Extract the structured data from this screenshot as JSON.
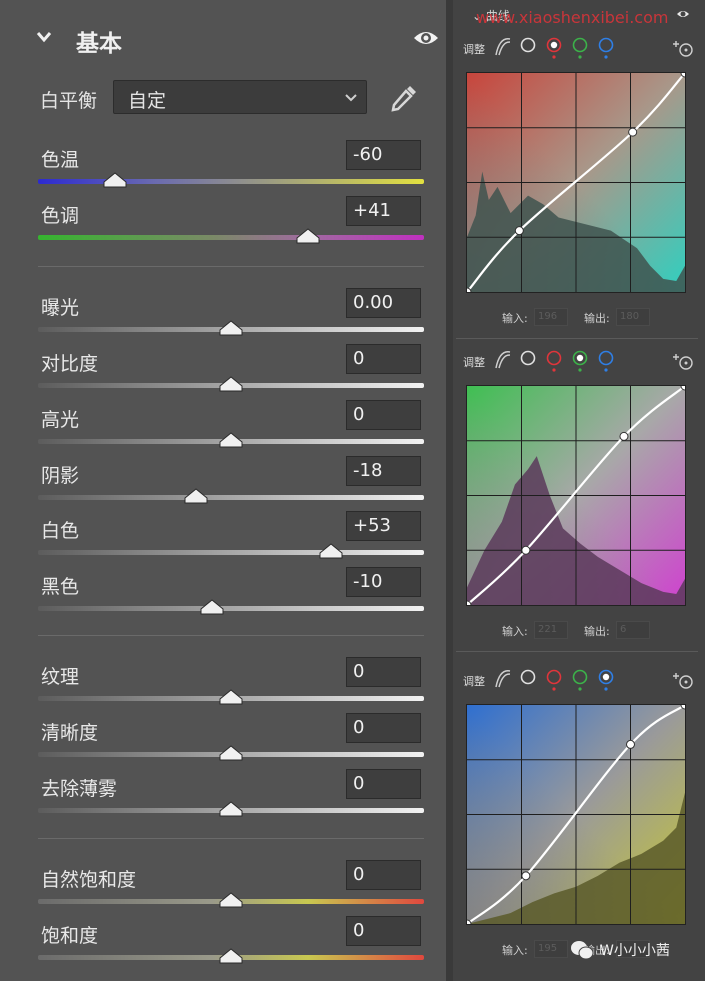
{
  "basic": {
    "title": "基本",
    "white_balance": {
      "label": "白平衡",
      "value": "自定"
    }
  },
  "sliders": [
    {
      "label": "色温",
      "value": "-60",
      "level": 0.2,
      "track": "temp"
    },
    {
      "label": "色调",
      "value": "+41",
      "level": 0.7,
      "track": "tint"
    },
    {
      "label": "曝光",
      "value": "0.00",
      "level": 0.5,
      "track": "gray"
    },
    {
      "label": "对比度",
      "value": "0",
      "level": 0.5,
      "track": "gray"
    },
    {
      "label": "高光",
      "value": "0",
      "level": 0.5,
      "track": "gray"
    },
    {
      "label": "阴影",
      "value": "-18",
      "level": 0.41,
      "track": "gray"
    },
    {
      "label": "白色",
      "value": "+53",
      "level": 0.76,
      "track": "gray"
    },
    {
      "label": "黑色",
      "value": "-10",
      "level": 0.45,
      "track": "gray"
    },
    {
      "label": "纹理",
      "value": "0",
      "level": 0.5,
      "track": "gray"
    },
    {
      "label": "清晰度",
      "value": "0",
      "level": 0.5,
      "track": "gray"
    },
    {
      "label": "去除薄雾",
      "value": "0",
      "level": 0.5,
      "track": "gray"
    },
    {
      "label": "自然饱和度",
      "value": "0",
      "level": 0.5,
      "track": "vib"
    },
    {
      "label": "饱和度",
      "value": "0",
      "level": 0.5,
      "track": "sat"
    }
  ],
  "curves": {
    "tab_label": "曲线",
    "watermark": "www.xiaoshenxibei.com",
    "adjust_label": "调整",
    "input_label": "输入:",
    "output_label": "输出:",
    "channels": [
      {
        "active": "red",
        "input": "196",
        "output": "180"
      },
      {
        "active": "green",
        "input": "221",
        "output": "6"
      },
      {
        "active": "blue",
        "input": "195",
        "output": ""
      }
    ]
  },
  "colors": {
    "panel_bg": "#535353",
    "curves_bg": "#434343",
    "red": "#e0353b",
    "green": "#3cb24a",
    "blue": "#2f7fe6"
  },
  "signature": "W小小小茜"
}
